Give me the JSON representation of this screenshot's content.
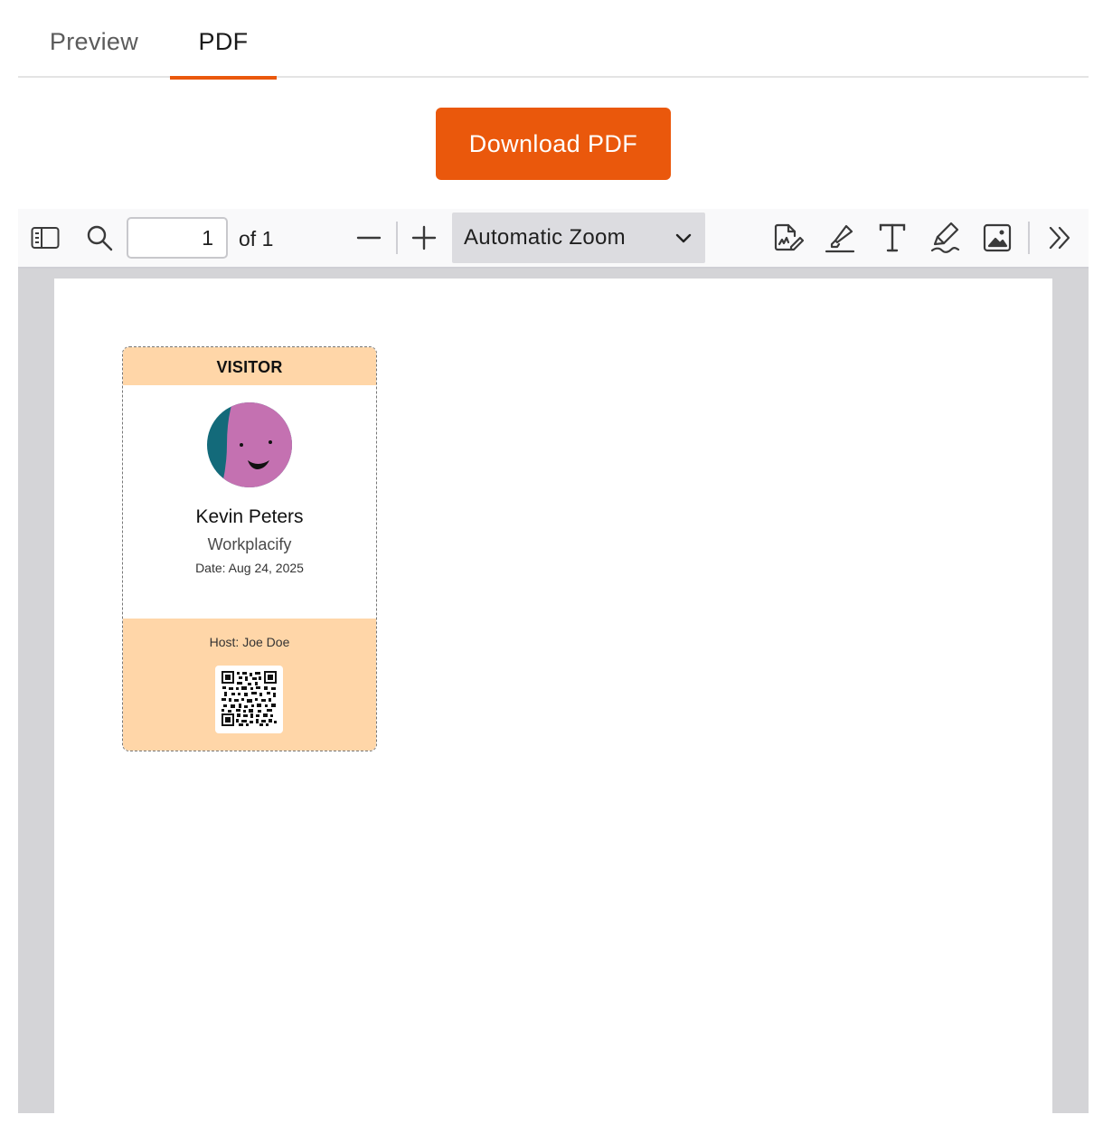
{
  "tabs": [
    {
      "label": "Preview",
      "active": false
    },
    {
      "label": "PDF",
      "active": true
    }
  ],
  "download": {
    "label": "Download PDF"
  },
  "toolbar": {
    "page_number": "1",
    "page_count_label": "of 1",
    "zoom": "Automatic Zoom",
    "icons": [
      "sidebar-toggle-icon",
      "search-icon",
      "zoom-out-icon",
      "zoom-in-icon",
      "chevron-down-icon",
      "signature-icon",
      "highlight-icon",
      "text-icon",
      "draw-icon",
      "image-icon",
      "more-tools-icon"
    ]
  },
  "badge": {
    "header": "VISITOR",
    "name": "Kevin Peters",
    "company": "Workplacify",
    "date": "Date: Aug 24, 2025",
    "host": "Host: Joe Doe"
  },
  "colors": {
    "accent": "#ea580c",
    "badge_band": "#ffd6a8",
    "avatar_primary": "#c471b1",
    "avatar_secondary": "#136a7a",
    "viewer_background": "#d4d4d7"
  }
}
